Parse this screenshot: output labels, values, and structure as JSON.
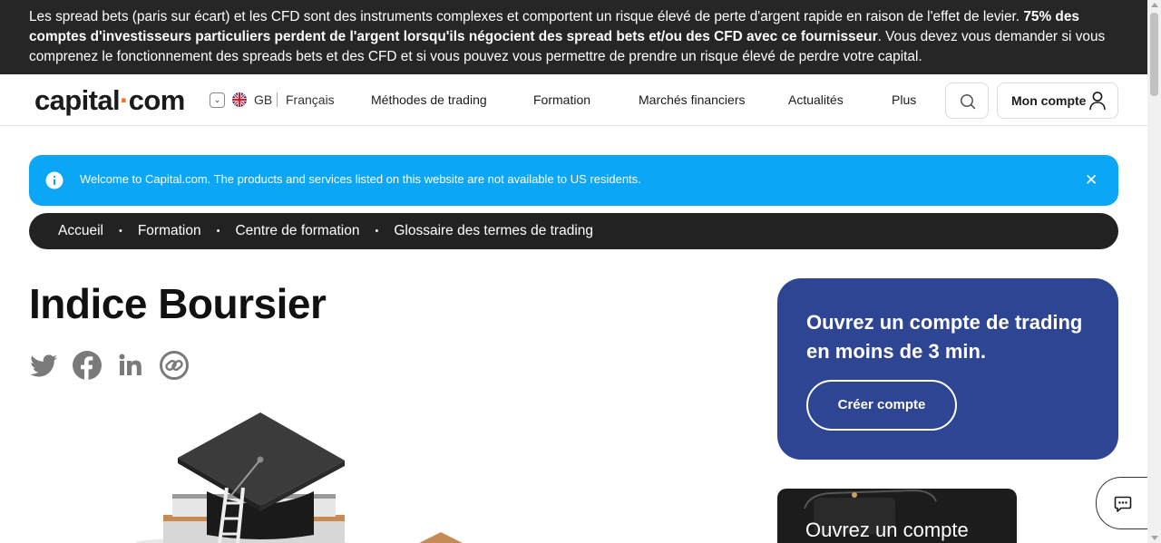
{
  "risk_warning": {
    "part1": "Les spread bets (paris sur écart) et les CFD sont des instruments complexes et comportent un risque élevé de perte d'argent rapide en raison de l'effet de levier. ",
    "bold": "75% des comptes d'investisseurs particuliers perdent de l'argent lorsqu'ils négocient des spread bets et/ou des CFD avec ce fournisseur",
    "part2": ". Vous devez vous demander si vous comprenez le fonctionnement des spreads bets et des CFD et si vous pouvez vous permettre de prendre un risque élevé de perdre votre capital."
  },
  "header": {
    "logo_left": "capital",
    "logo_dot": "·",
    "logo_right": "com",
    "country": "GB",
    "language": "Français",
    "nav": [
      "Méthodes de trading",
      "Formation",
      "Marchés financiers",
      "Actualités",
      "Plus"
    ],
    "account_label": "Mon compte"
  },
  "notice": {
    "message": "Welcome to Capital.com. The products and services listed on this website are not available to US residents.",
    "close": "✕"
  },
  "breadcrumb": [
    "Accueil",
    "Formation",
    "Centre de formation",
    "Glossaire des termes de trading"
  ],
  "breadcrumb_separator": "•",
  "page": {
    "title": "Indice Boursier"
  },
  "share": [
    "twitter-icon",
    "facebook-icon",
    "linkedin-icon",
    "copy-link-icon"
  ],
  "cta": {
    "title": "Ouvrez un compte de trading en moins de 3 min.",
    "button": "Créer compte"
  },
  "promo": {
    "text": "Ouvrez un compte"
  },
  "colors": {
    "banner_bg": "#262626",
    "notice_bg": "#0ba6f5",
    "breadcrumb_bg": "#222222",
    "cta_bg": "#2e4594",
    "logo_accent": "#f76b1c"
  }
}
